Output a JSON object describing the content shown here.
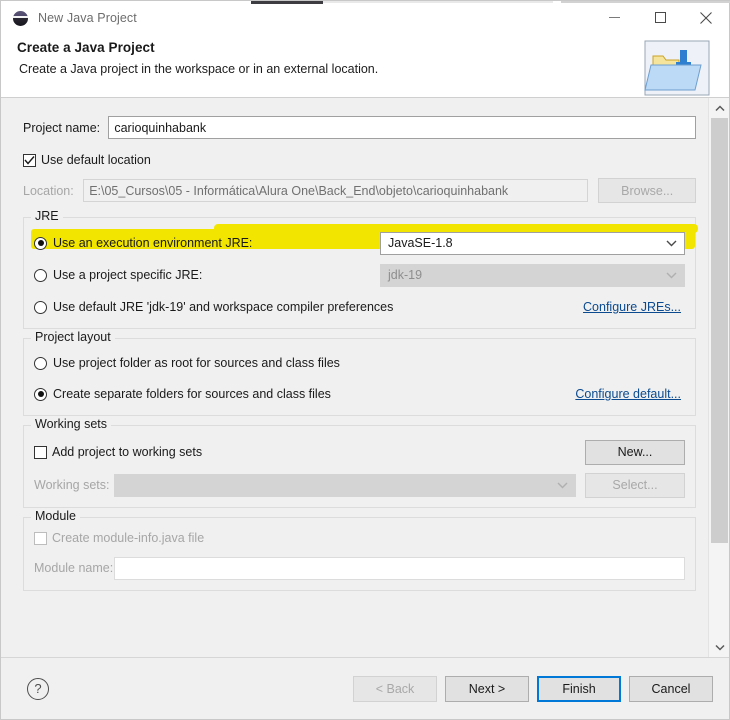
{
  "window": {
    "title": "New Java Project",
    "icon": "eclipse-sphere-icon",
    "minimize_label": "Minimize",
    "maximize_label": "Maximize",
    "close_label": "Close"
  },
  "header": {
    "title": "Create a Java Project",
    "subtitle": "Create a Java project in the workspace or in an external location.",
    "icon": "new-java-project-folder-icon"
  },
  "form": {
    "project_name_label": "Project name:",
    "project_name_value": "carioquinhabank",
    "project_name_placeholder": "",
    "use_default_location_label": "Use default location",
    "use_default_location_checked": true,
    "location_label": "Location:",
    "location_value": "E:\\05_Cursos\\05 - Informática\\Alura One\\Back_End\\objeto\\carioquinhabank",
    "browse_label": "Browse..."
  },
  "jre": {
    "legend": "JRE",
    "option_execution_env_label": "Use an execution environment JRE:",
    "option_execution_env_selected": true,
    "execution_env_value": "JavaSE-1.8",
    "option_project_specific_label": "Use a project specific JRE:",
    "option_project_specific_selected": false,
    "project_specific_value": "jdk-19",
    "option_default_jre_label": "Use default JRE 'jdk-19' and workspace compiler preferences",
    "option_default_jre_selected": false,
    "configure_jres_link": "Configure JREs...",
    "highlight_color": "#f2e600"
  },
  "project_layout": {
    "legend": "Project layout",
    "option_root_label": "Use project folder as root for sources and class files",
    "option_root_selected": false,
    "option_separate_label": "Create separate folders for sources and class files",
    "option_separate_selected": true,
    "configure_default_link": "Configure default..."
  },
  "working_sets": {
    "legend": "Working sets",
    "add_project_label": "Add project to working sets",
    "add_project_checked": false,
    "new_label": "New...",
    "working_sets_label": "Working sets:",
    "working_sets_value": "",
    "select_label": "Select..."
  },
  "module": {
    "legend": "Module",
    "create_module_info_label": "Create module-info.java file",
    "create_module_info_checked": false,
    "module_name_label": "Module name:",
    "module_name_value": ""
  },
  "footer": {
    "help_label": "?",
    "back_label": "< Back",
    "back_disabled": true,
    "next_label": "Next >",
    "finish_label": "Finish",
    "finish_default": true,
    "cancel_label": "Cancel"
  }
}
